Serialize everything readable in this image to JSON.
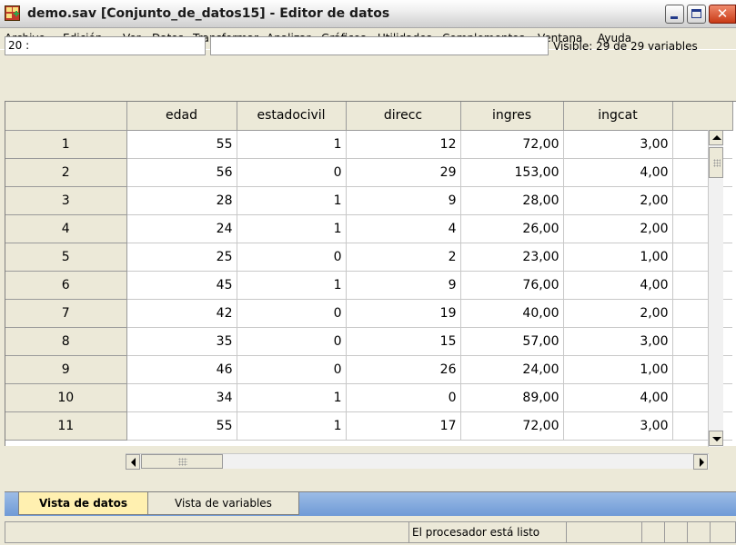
{
  "window": {
    "title": "demo.sav [Conjunto_de_datos15] - Editor de datos",
    "icon": "spss-data-editor-icon",
    "controls": [
      "minimize-icon",
      "maximize-icon",
      "close-icon"
    ]
  },
  "menu": {
    "items": [
      {
        "label": "Archivo"
      },
      {
        "label": "Edición",
        "accel_index": 0
      },
      {
        "label": "Ver",
        "accel_index": 0
      },
      {
        "label": "Datos",
        "accel_index": 0
      },
      {
        "label": "Transformar",
        "accel_index": 0
      },
      {
        "label": "Analizar",
        "accel_index": 0
      },
      {
        "label": "Gráficos",
        "accel_index": 0
      },
      {
        "label": "Utilidades",
        "accel_index": 0
      },
      {
        "label": "Complementos",
        "accel_index": 2
      },
      {
        "label": "Ventana"
      },
      {
        "label": "Ayuda"
      }
    ]
  },
  "cellbar": {
    "cell_reference": "20 :",
    "cell_value": "",
    "visible": "Visible: 29 de 29 variables"
  },
  "grid": {
    "columns": [
      "edad",
      "estadocivil",
      "direcc",
      "ingres",
      "ingcat"
    ],
    "rows": [
      {
        "num": "1",
        "values": [
          "55",
          "1",
          "12",
          "72,00",
          "3,00"
        ]
      },
      {
        "num": "2",
        "values": [
          "56",
          "0",
          "29",
          "153,00",
          "4,00"
        ]
      },
      {
        "num": "3",
        "values": [
          "28",
          "1",
          "9",
          "28,00",
          "2,00"
        ]
      },
      {
        "num": "4",
        "values": [
          "24",
          "1",
          "4",
          "26,00",
          "2,00"
        ]
      },
      {
        "num": "5",
        "values": [
          "25",
          "0",
          "2",
          "23,00",
          "1,00"
        ]
      },
      {
        "num": "6",
        "values": [
          "45",
          "1",
          "9",
          "76,00",
          "4,00"
        ]
      },
      {
        "num": "7",
        "values": [
          "42",
          "0",
          "19",
          "40,00",
          "2,00"
        ]
      },
      {
        "num": "8",
        "values": [
          "35",
          "0",
          "15",
          "57,00",
          "3,00"
        ]
      },
      {
        "num": "9",
        "values": [
          "46",
          "0",
          "26",
          "24,00",
          "1,00"
        ]
      },
      {
        "num": "10",
        "values": [
          "34",
          "1",
          "0",
          "89,00",
          "4,00"
        ]
      },
      {
        "num": "11",
        "values": [
          "55",
          "1",
          "17",
          "72,00",
          "3,00"
        ]
      }
    ]
  },
  "tabs": [
    {
      "label": "Vista de datos",
      "active": true
    },
    {
      "label": "Vista de variables",
      "active": false
    }
  ],
  "status": {
    "message": "El procesador está listo"
  },
  "colors": {
    "window_bg": "#ece9d8",
    "active_tab_bg": "#fff0b0",
    "tab_strip_bg": "#7fa6dd",
    "close_button": "#d4502a"
  }
}
